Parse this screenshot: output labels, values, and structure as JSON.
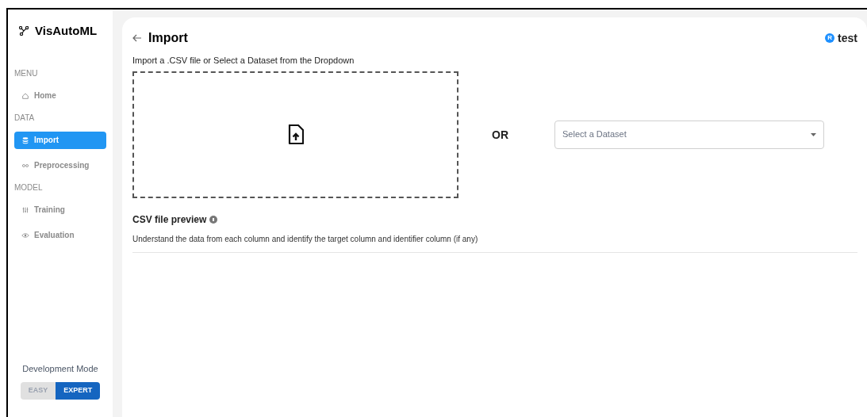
{
  "app": {
    "title": "VisAutoML"
  },
  "sidebar": [
    {
      "kind": "section",
      "label": "MENU"
    },
    {
      "kind": "item",
      "label": "Home",
      "selected": false
    },
    {
      "kind": "section",
      "label": "DATA"
    },
    {
      "kind": "item",
      "label": "Import",
      "selected": true
    },
    {
      "kind": "item",
      "label": "Preprocessing",
      "selected": false
    },
    {
      "kind": "section",
      "label": "MODEL"
    },
    {
      "kind": "item",
      "label": "Training",
      "selected": false
    },
    {
      "kind": "item",
      "label": "Evaluation",
      "selected": false
    }
  ],
  "mode": {
    "label": "Development Mode",
    "options": [
      {
        "label": "EASY",
        "selected": false
      },
      {
        "label": "EXPERT",
        "selected": true
      }
    ]
  },
  "page": {
    "title": "Import",
    "user": {
      "avatar": "R",
      "name": "test"
    },
    "instruction": "Import a .CSV file or Select a Dataset from the Dropdown",
    "separator": "OR",
    "dataset_select": {
      "placeholder": "Select a Dataset"
    },
    "preview": {
      "title": "CSV file preview",
      "description": "Understand the data from each column and identify the target column and identifier column (if any)"
    }
  }
}
